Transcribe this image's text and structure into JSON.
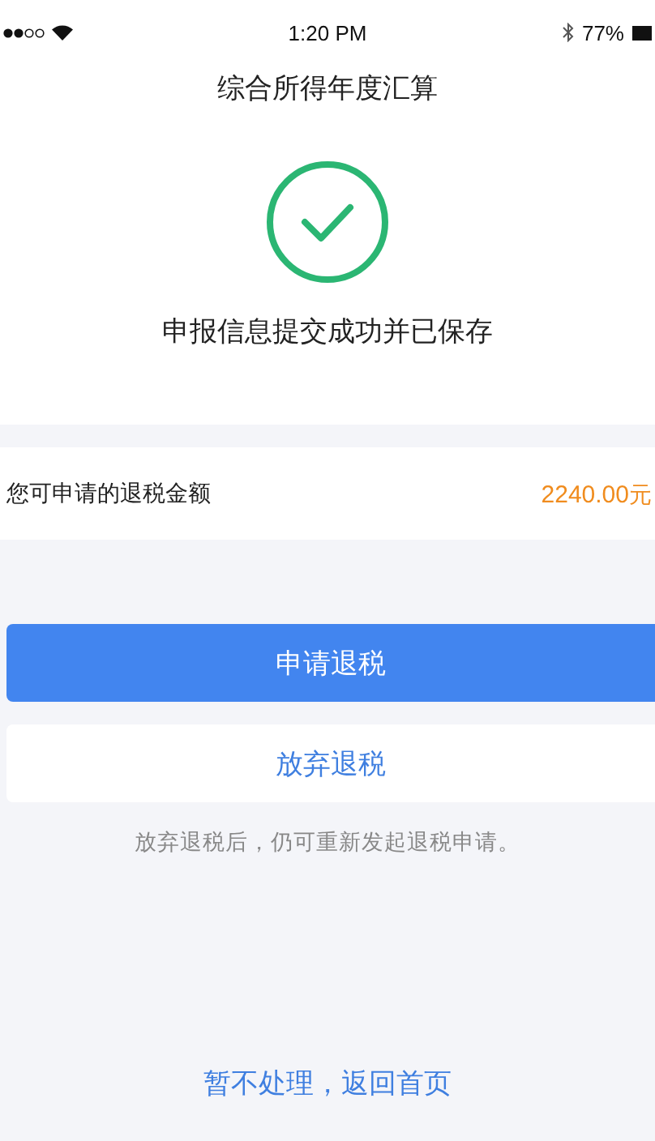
{
  "status_bar": {
    "time": "1:20 PM",
    "battery": "77%"
  },
  "nav": {
    "title": "综合所得年度汇算"
  },
  "result": {
    "message": "申报信息提交成功并已保存"
  },
  "refund": {
    "label": "您可申请的退税金额",
    "amount": "2240.00",
    "unit": "元"
  },
  "buttons": [
    {
      "label": "申请退税",
      "kind": "primary"
    },
    {
      "label": "放弃退税",
      "kind": "secondary"
    }
  ],
  "note": "放弃退税后，仍可重新发起退税申请。",
  "link": "暂不处理，返回首页"
}
